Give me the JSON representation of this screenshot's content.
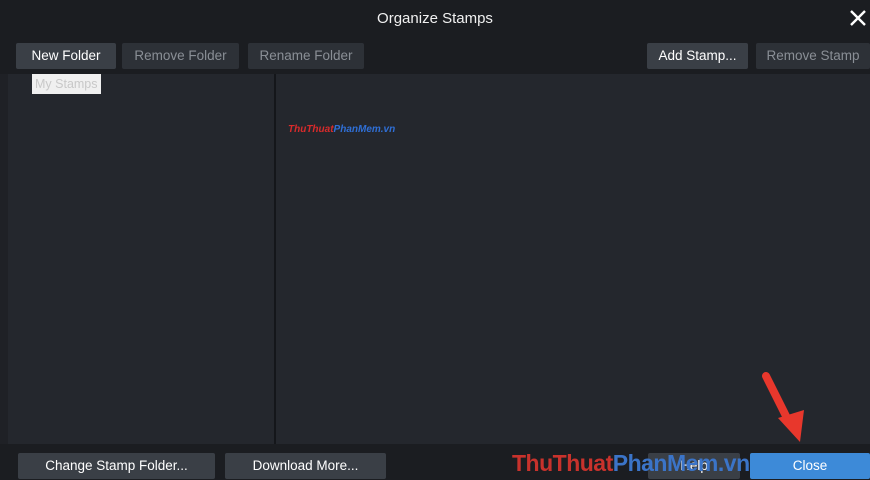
{
  "window": {
    "title": "Organize Stamps"
  },
  "toolbar": {
    "new_folder": "New Folder",
    "remove_folder": "Remove Folder",
    "rename_folder": "Rename Folder",
    "add_stamp": "Add Stamp...",
    "remove_stamp": "Remove Stamp"
  },
  "folders": {
    "items": [
      {
        "label": "My Stamps",
        "selected": true
      }
    ]
  },
  "stamps": {
    "items": [
      {
        "part1": "ThuThuat",
        "part2": "PhanMem.vn"
      }
    ]
  },
  "footer": {
    "change_folder": "Change Stamp Folder...",
    "download_more": "Download More...",
    "help": "Help",
    "close": "Close"
  },
  "watermark": {
    "part1": "ThuThuat",
    "part2": "PhanMem.vn"
  },
  "colors": {
    "accent": "#3d8ad8",
    "arrow": "#e8372c",
    "background": "#1f2126"
  }
}
